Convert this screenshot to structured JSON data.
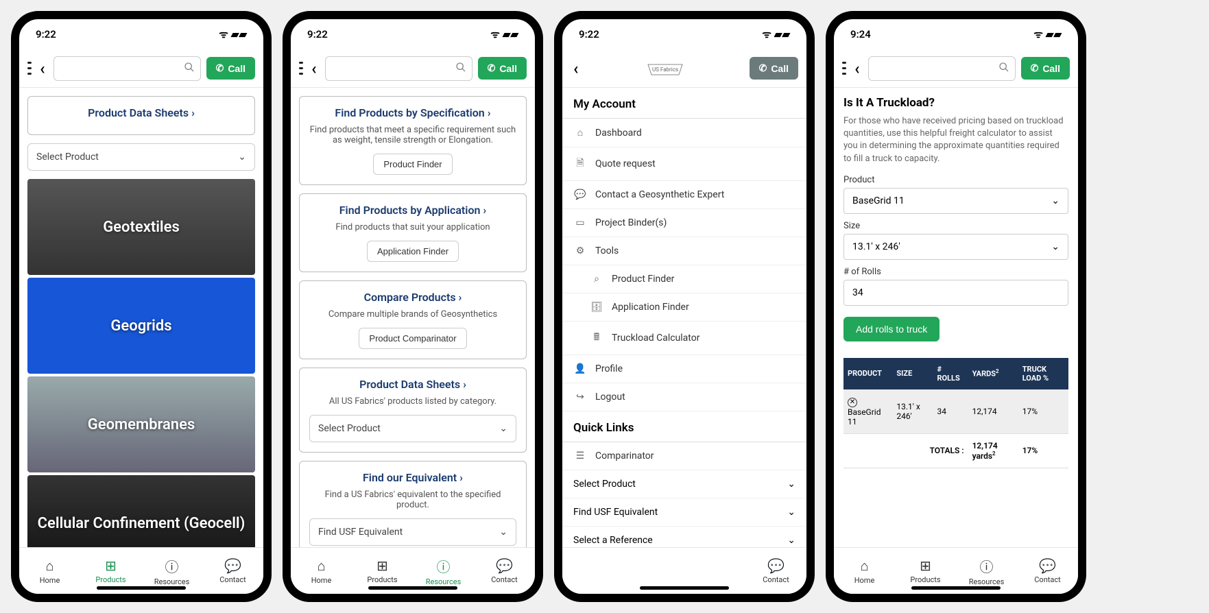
{
  "status": {
    "time1": "9:22",
    "time4": "9:24"
  },
  "header": {
    "call": "Call"
  },
  "tabs": {
    "home": "Home",
    "products": "Products",
    "resources": "Resources",
    "contact": "Contact"
  },
  "p1": {
    "pds_title": "Product Data Sheets",
    "select_product": "Select Product",
    "cat1": "Geotextiles",
    "cat2": "Geogrids",
    "cat3": "Geomembranes",
    "cat4": "Cellular Confinement (Geocell)"
  },
  "p2": {
    "c1_title": "Find Products by Specification",
    "c1_desc": "Find products that meet a specific requirement such as weight, tensile strength or Elongation.",
    "c1_btn": "Product Finder",
    "c2_title": "Find Products by Application",
    "c2_desc": "Find products that suit your application",
    "c2_btn": "Application Finder",
    "c3_title": "Compare Products",
    "c3_desc": "Compare multiple brands of Geosynthetics",
    "c3_btn": "Product Comparinator",
    "c4_title": "Product Data Sheets",
    "c4_desc": "All US Fabrics' products listed by category.",
    "c4_sel": "Select Product",
    "c5_title": "Find our Equivalent",
    "c5_desc": "Find a US Fabrics' equivalent to the specified product.",
    "c5_sel": "Find USF Equivalent"
  },
  "p3": {
    "account": "My Account",
    "dashboard": "Dashboard",
    "quote": "Quote request",
    "expert": "Contact a Geosynthetic Expert",
    "binder": "Project Binder(s)",
    "tools": "Tools",
    "pfinder": "Product Finder",
    "afinder": "Application Finder",
    "tcalc": "Truckload Calculator",
    "profile": "Profile",
    "logout": "Logout",
    "quick": "Quick Links",
    "comp": "Comparinator",
    "sel1": "Select Product",
    "sel2": "Find USF Equivalent",
    "sel3": "Select a Reference"
  },
  "p4": {
    "heading": "Is It A Truckload?",
    "desc": "For those who have received pricing based on truckload quantities, use this helpful freight calculator to assist you in determining the approximate quantities required to fill a truck to capacity.",
    "product_label": "Product",
    "product_val": "BaseGrid 11",
    "size_label": "Size",
    "size_val": "13.1' x 246'",
    "rolls_label": "# of Rolls",
    "rolls_val": "34",
    "add_btn": "Add rolls to truck",
    "th_product": "PRODUCT",
    "th_size": "SIZE",
    "th_rolls": "# ROLLS",
    "th_yards": "YARDS",
    "th_load": "TRUCK LOAD %",
    "row_product": "BaseGrid 11",
    "row_size": "13.1' x 246'",
    "row_rolls": "34",
    "row_yards": "12,174",
    "row_load": "17%",
    "totals_label": "TOTALS :",
    "totals_yards": "12,174 yards",
    "totals_load": "17%"
  }
}
